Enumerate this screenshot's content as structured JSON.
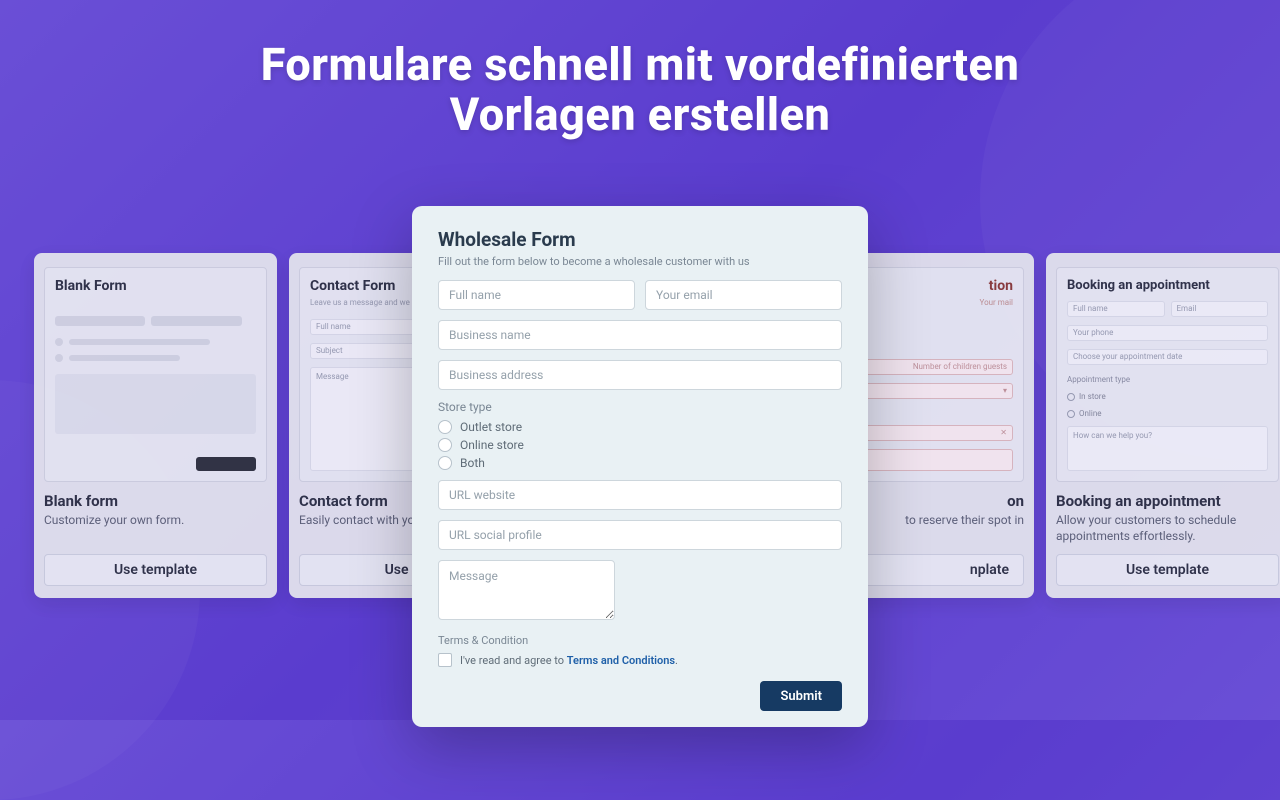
{
  "heading": {
    "line1": "Formulare schnell mit vordefinierten",
    "line2": "Vorlagen erstellen"
  },
  "use_template_label": "Use template",
  "cards": {
    "blank": {
      "preview_title": "Blank Form",
      "title": "Blank form",
      "desc": "Customize your own form."
    },
    "contact": {
      "preview_title": "Contact Form",
      "preview_sub": "Leave us a message and we will get...",
      "field_fullname": "Full name",
      "field_subject": "Subject",
      "field_message": "Message",
      "title": "Contact form",
      "desc": "Easily contact with your"
    },
    "reservation": {
      "preview_title_suffix": "tion",
      "field_mail": "Your mail",
      "field_guests": "Number of children guests",
      "title_suffix": "on",
      "desc_suffix": "to reserve their spot in"
    },
    "booking": {
      "preview_title": "Booking an appointment",
      "field_fullname": "Full name",
      "field_email": "Email",
      "field_phone": "Your phone",
      "field_date": "Choose your appointment date",
      "appt_type_label": "Appointment type",
      "opt_instore": "In store",
      "opt_online": "Online",
      "field_help": "How can we help you?",
      "title": "Booking an appointment",
      "desc": "Allow your customers to schedule appointments effortlessly."
    }
  },
  "modal": {
    "title": "Wholesale Form",
    "sub": "Fill out the form below to become a wholesale customer with us",
    "fullname_ph": "Full name",
    "email_ph": "Your email",
    "business_name_ph": "Business name",
    "business_address_ph": "Business address",
    "store_type_label": "Store type",
    "opt_outlet": "Outlet store",
    "opt_online": "Online store",
    "opt_both": "Both",
    "url_website_ph": "URL website",
    "url_social_ph": "URL social profile",
    "message_ph": "Message",
    "terms_label": "Terms & Condition",
    "agree_prefix": "I've read and agree to ",
    "terms_link": "Terms and Conditions",
    "agree_suffix": ".",
    "submit": "Submit"
  }
}
